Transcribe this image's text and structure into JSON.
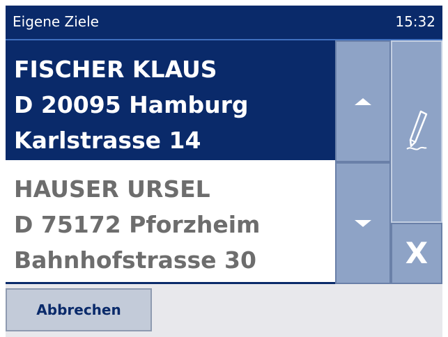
{
  "header": {
    "title": "Eigene Ziele",
    "time": "15:32"
  },
  "entries": [
    {
      "name": "FISCHER KLAUS",
      "city": "D 20095 Hamburg",
      "street": "Karlstrasse 14",
      "selected": true
    },
    {
      "name": "HAUSER URSEL",
      "city": "D 75172 Pforzheim",
      "street": "Bahnhofstrasse 30",
      "selected": false
    }
  ],
  "buttons": {
    "scroll_up_icon": "triangle-up-icon",
    "scroll_down_icon": "triangle-down-icon",
    "edit_icon": "pencil-icon",
    "close_glyph": "X",
    "cancel_label": "Abbrechen"
  },
  "colors": {
    "titlebar": "#0a2a6a",
    "selected": "#0a2a6a",
    "button": "#8ea3c6",
    "text_gray": "#6d6d6d"
  }
}
